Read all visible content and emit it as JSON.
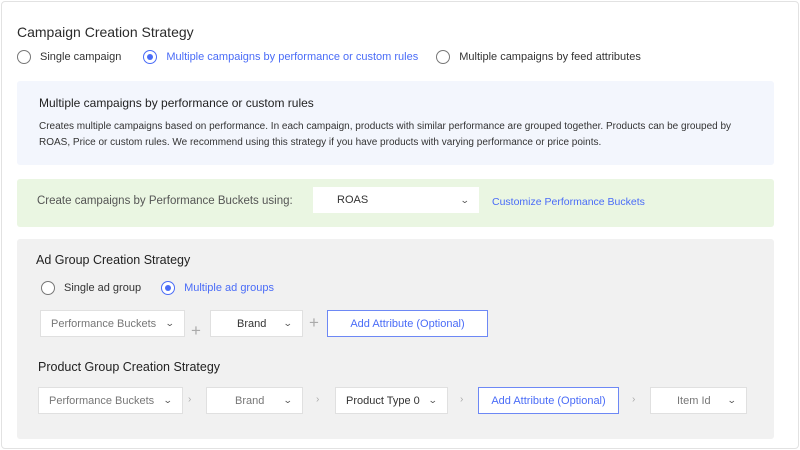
{
  "campaign": {
    "title": "Campaign Creation Strategy",
    "options": [
      {
        "label": "Single campaign",
        "selected": false
      },
      {
        "label": "Multiple campaigns by performance or custom rules",
        "selected": true
      },
      {
        "label": "Multiple campaigns by feed attributes",
        "selected": false
      }
    ]
  },
  "info": {
    "heading": "Multiple campaigns by performance or custom rules",
    "body": "Creates multiple campaigns based on performance. In each campaign, products with similar performance are grouped together. Products can be grouped by ROAS, Price or custom rules. We recommend using this strategy if you have products with varying performance or price points."
  },
  "buckets": {
    "label": "Create campaigns by Performance Buckets using:",
    "selected_value": "ROAS",
    "customize_link": "Customize Performance Buckets"
  },
  "ad_group": {
    "title": "Ad Group Creation Strategy",
    "options": [
      {
        "label": "Single ad group",
        "selected": false
      },
      {
        "label": "Multiple ad groups",
        "selected": true
      }
    ],
    "selects": [
      "Performance Buckets",
      "Brand"
    ],
    "add_attribute": "Add Attribute (Optional)",
    "plus": "+"
  },
  "product_group": {
    "title": "Product Group Creation Strategy",
    "selects": [
      "Performance Buckets",
      "Brand",
      "Product Type 0"
    ],
    "add_attribute": "Add Attribute (Optional)",
    "last_select": "Item Id",
    "separator": "›"
  },
  "icons": {
    "chevron": "⌄"
  },
  "colors": {
    "accent": "#4a6cf7",
    "info_bg": "#f3f6fd",
    "bucket_bg": "#eaf6e2",
    "panel_bg": "#f1f1f1"
  }
}
